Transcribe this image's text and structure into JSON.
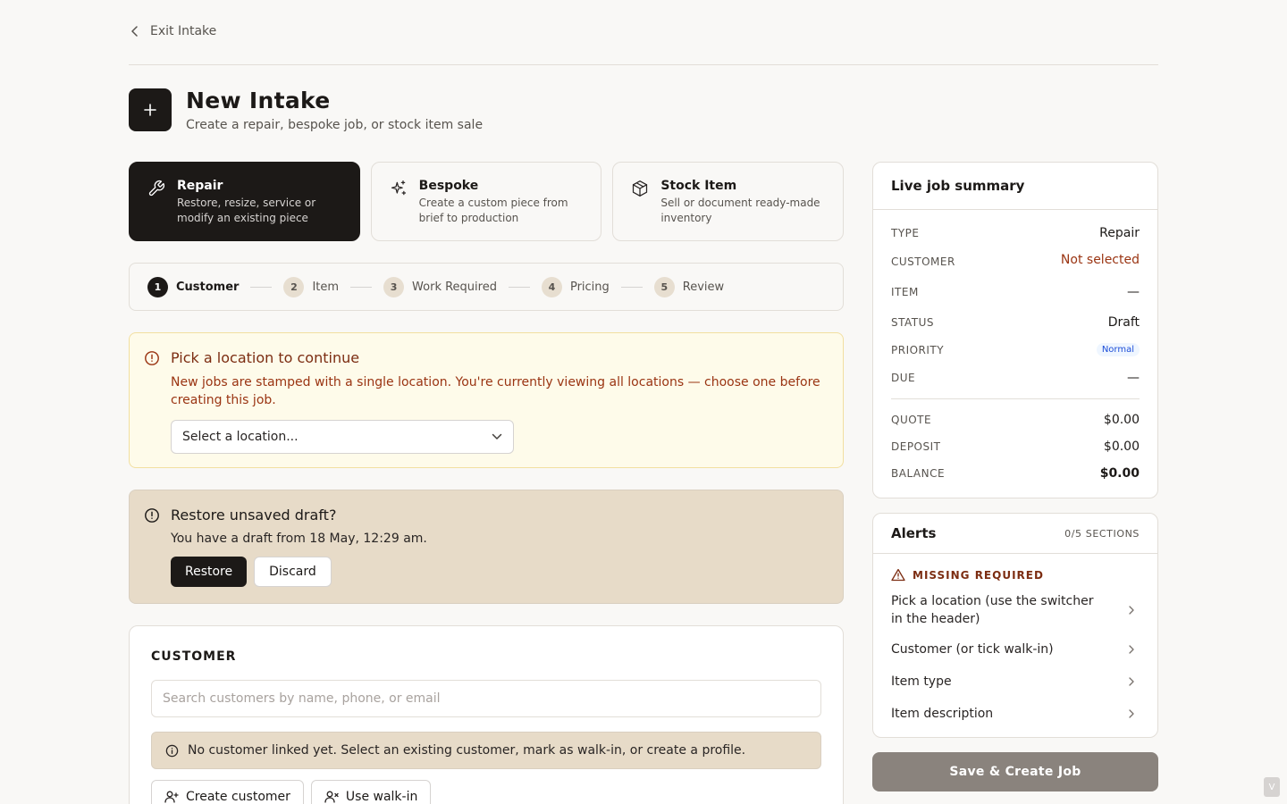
{
  "topbar": {
    "exit_label": "Exit Intake"
  },
  "header": {
    "title": "New Intake",
    "subtitle": "Create a repair, bespoke job, or stock item sale"
  },
  "types": [
    {
      "name": "Repair",
      "desc": "Restore, resize, service or modify an existing piece",
      "icon": "wrench-icon",
      "active": true
    },
    {
      "name": "Bespoke",
      "desc": "Create a custom piece from brief to production",
      "icon": "sparkles-icon",
      "active": false
    },
    {
      "name": "Stock Item",
      "desc": "Sell or document ready-made inventory",
      "icon": "package-icon",
      "active": false
    }
  ],
  "steps": [
    {
      "num": "1",
      "label": "Customer"
    },
    {
      "num": "2",
      "label": "Item"
    },
    {
      "num": "3",
      "label": "Work Required"
    },
    {
      "num": "4",
      "label": "Pricing"
    },
    {
      "num": "5",
      "label": "Review"
    }
  ],
  "location_alert": {
    "title": "Pick a location to continue",
    "body": "New jobs are stamped with a single location. You're currently viewing all locations — choose one before creating this job.",
    "select_value": "Select a location..."
  },
  "draft_alert": {
    "title": "Restore unsaved draft?",
    "body": "You have a draft from 18 May, 12:29 am.",
    "restore_label": "Restore",
    "discard_label": "Discard"
  },
  "customer": {
    "title": "CUSTOMER",
    "search_placeholder": "Search customers by name, phone, or email",
    "info": "No customer linked yet. Select an existing customer, mark as walk-in, or create a profile.",
    "create_label": "Create customer",
    "walkin_label": "Use walk-in"
  },
  "summary": {
    "title": "Live job summary",
    "type_k": "TYPE",
    "type_v": "Repair",
    "customer_k": "CUSTOMER",
    "customer_v": "Not selected",
    "item_k": "ITEM",
    "item_v": "—",
    "status_k": "STATUS",
    "status_v": "Draft",
    "priority_k": "PRIORITY",
    "priority_v": "Normal",
    "due_k": "DUE",
    "due_v": "—",
    "quote_k": "QUOTE",
    "quote_v": "$0.00",
    "deposit_k": "DEPOSIT",
    "deposit_v": "$0.00",
    "balance_k": "BALANCE",
    "balance_v": "$0.00"
  },
  "alerts": {
    "title": "Alerts",
    "meta": "0/5 SECTIONS",
    "missing_label": "MISSING REQUIRED",
    "items": [
      "Pick a location (use the switcher in the header)",
      "Customer (or tick walk-in)",
      "Item type",
      "Item description"
    ]
  },
  "save_label": "Save & Create Job",
  "corner_label": "V"
}
